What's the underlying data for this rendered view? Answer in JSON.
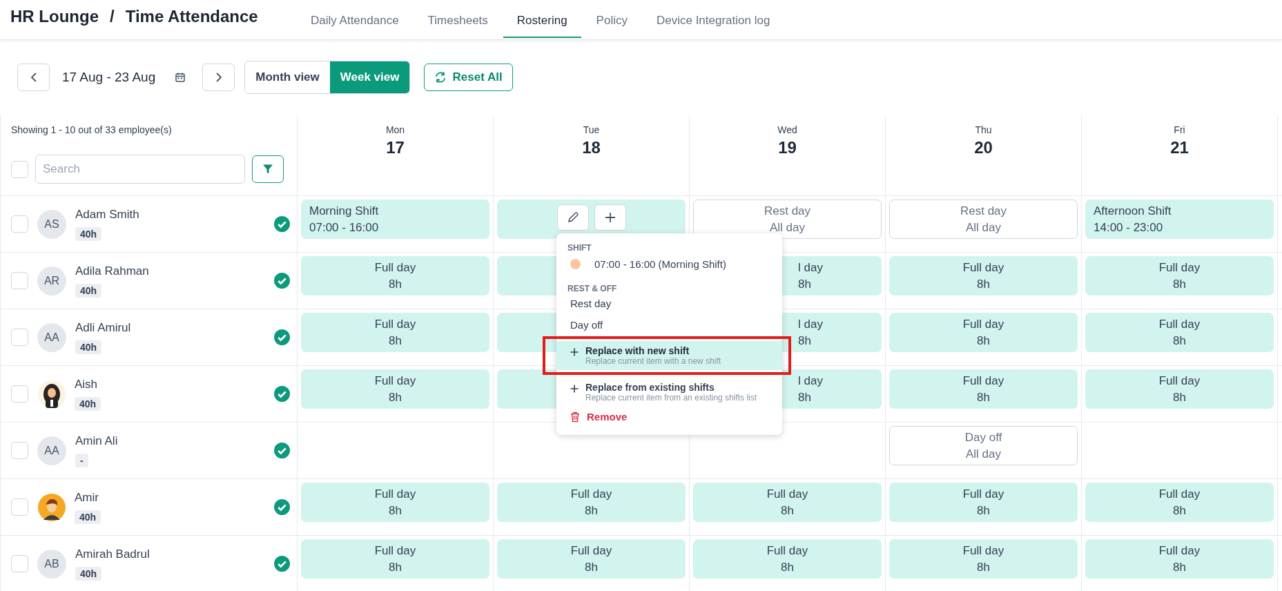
{
  "header": {
    "breadcrumb": {
      "items": [
        "HR Lounge",
        "Time Attendance"
      ],
      "separator": "/"
    },
    "tabs": [
      {
        "label": "Daily Attendance",
        "selected": false
      },
      {
        "label": "Timesheets",
        "selected": false
      },
      {
        "label": "Rostering",
        "selected": true
      },
      {
        "label": "Policy",
        "selected": false
      },
      {
        "label": "Device Integration log",
        "selected": false
      }
    ]
  },
  "toolbar": {
    "date_range": "17 Aug - 23 Aug",
    "views": [
      {
        "label": "Month view",
        "selected": false
      },
      {
        "label": "Week view",
        "selected": true
      }
    ],
    "reset": "Reset All"
  },
  "sidebar": {
    "summary": "Showing 1 - 10 out of 33 employee(s)",
    "select_all": {
      "checked": false
    },
    "search": {
      "placeholder": "Search"
    }
  },
  "days": [
    {
      "weekday": "Mon",
      "date": "17"
    },
    {
      "weekday": "Tue",
      "date": "18"
    },
    {
      "weekday": "Wed",
      "date": "19"
    },
    {
      "weekday": "Thu",
      "date": "20"
    },
    {
      "weekday": "Fri",
      "date": "21"
    }
  ],
  "employees": [
    {
      "name": "Adam Smith",
      "avatar": {
        "kind": "initials",
        "text": "AS"
      },
      "hours": "40h",
      "checked": false,
      "approved": true,
      "cells": [
        {
          "kind": "shift",
          "lines": [
            "Morning Shift",
            "07:00 - 16:00"
          ]
        },
        {
          "kind": "active"
        },
        {
          "kind": "rest",
          "lines": [
            "Rest day",
            "All day"
          ]
        },
        {
          "kind": "rest",
          "lines": [
            "Rest day",
            "All day"
          ]
        },
        {
          "kind": "shift",
          "lines": [
            "Afternoon Shift",
            "14:00 - 23:00"
          ]
        }
      ]
    },
    {
      "name": "Adila Rahman",
      "avatar": {
        "kind": "initials",
        "text": "AR"
      },
      "hours": "40h",
      "checked": false,
      "approved": true,
      "cells": [
        {
          "kind": "full",
          "lines": [
            "Full day",
            "8h"
          ]
        },
        {
          "kind": "covered"
        },
        {
          "kind": "partial",
          "lines": [
            "l day",
            "8h"
          ]
        },
        {
          "kind": "full",
          "lines": [
            "Full day",
            "8h"
          ]
        },
        {
          "kind": "full",
          "lines": [
            "Full day",
            "8h"
          ]
        }
      ]
    },
    {
      "name": "Adli Amirul",
      "avatar": {
        "kind": "initials",
        "text": "AA"
      },
      "hours": "40h",
      "checked": false,
      "approved": true,
      "cells": [
        {
          "kind": "full",
          "lines": [
            "Full day",
            "8h"
          ]
        },
        {
          "kind": "covered"
        },
        {
          "kind": "partial",
          "lines": [
            "l day",
            "8h"
          ]
        },
        {
          "kind": "full",
          "lines": [
            "Full day",
            "8h"
          ]
        },
        {
          "kind": "full",
          "lines": [
            "Full day",
            "8h"
          ]
        }
      ]
    },
    {
      "name": "Aish",
      "avatar": {
        "kind": "woman"
      },
      "hours": "40h",
      "checked": false,
      "approved": true,
      "cells": [
        {
          "kind": "full",
          "lines": [
            "Full day",
            "8h"
          ]
        },
        {
          "kind": "covered"
        },
        {
          "kind": "partial",
          "lines": [
            "l day",
            "8h"
          ]
        },
        {
          "kind": "full",
          "lines": [
            "Full day",
            "8h"
          ]
        },
        {
          "kind": "full",
          "lines": [
            "Full day",
            "8h"
          ]
        }
      ]
    },
    {
      "name": "Amin Ali",
      "avatar": {
        "kind": "initials",
        "text": "AA"
      },
      "hours": "-",
      "checked": false,
      "approved": true,
      "cells": [
        {
          "kind": "empty"
        },
        {
          "kind": "empty"
        },
        {
          "kind": "empty"
        },
        {
          "kind": "rest",
          "lines": [
            "Day off",
            "All day"
          ]
        },
        {
          "kind": "empty"
        }
      ]
    },
    {
      "name": "Amir",
      "avatar": {
        "kind": "man"
      },
      "hours": "40h",
      "checked": false,
      "approved": true,
      "cells": [
        {
          "kind": "full",
          "lines": [
            "Full day",
            "8h"
          ]
        },
        {
          "kind": "full",
          "lines": [
            "Full day",
            "8h"
          ]
        },
        {
          "kind": "full",
          "lines": [
            "Full day",
            "8h"
          ]
        },
        {
          "kind": "full",
          "lines": [
            "Full day",
            "8h"
          ]
        },
        {
          "kind": "full",
          "lines": [
            "Full day",
            "8h"
          ]
        }
      ]
    },
    {
      "name": "Amirah Badrul",
      "avatar": {
        "kind": "initials",
        "text": "AB"
      },
      "hours": "40h",
      "checked": false,
      "approved": true,
      "cells": [
        {
          "kind": "full",
          "lines": [
            "Full day",
            "8h"
          ]
        },
        {
          "kind": "full",
          "lines": [
            "Full day",
            "8h"
          ]
        },
        {
          "kind": "full",
          "lines": [
            "Full day",
            "8h"
          ]
        },
        {
          "kind": "full",
          "lines": [
            "Full day",
            "8h"
          ]
        },
        {
          "kind": "full",
          "lines": [
            "Full day",
            "8h"
          ]
        }
      ]
    }
  ],
  "menu": {
    "sections": [
      {
        "heading": "SHIFT",
        "items": [
          {
            "kind": "shift",
            "label": "07:00 - 16:00 (Morning Shift)",
            "color": "#fdc4a0"
          }
        ]
      },
      {
        "heading": "REST & OFF",
        "items": [
          {
            "kind": "plain",
            "label": "Rest day"
          },
          {
            "kind": "plain",
            "label": "Day off"
          }
        ]
      }
    ],
    "actions": [
      {
        "kind": "add",
        "title": "Replace with new shift",
        "description": "Replace current item with a new shift",
        "selected": true,
        "highlighted": true
      },
      {
        "kind": "add",
        "title": "Replace from existing shifts",
        "description": "Replace current item from an existing shifts list",
        "selected": false,
        "highlighted": false
      },
      {
        "kind": "remove",
        "title": "Remove"
      }
    ]
  }
}
